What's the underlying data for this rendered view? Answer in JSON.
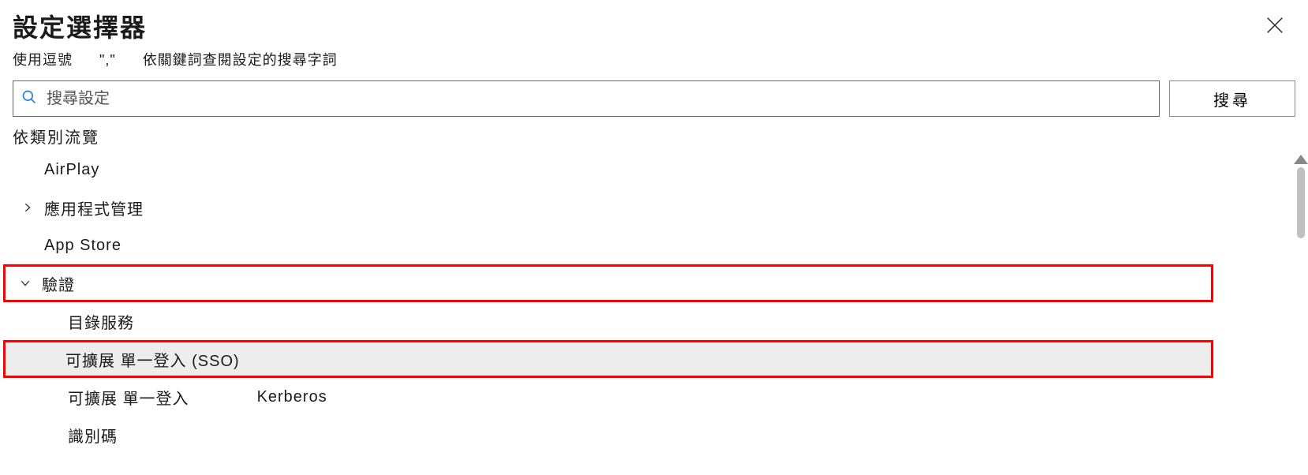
{
  "header": {
    "title": "設定選擇器",
    "subtitle_prefix": "使用逗號",
    "subtitle_comma": "\",\"",
    "subtitle_suffix": "依關鍵詞查閱設定的搜尋字詞"
  },
  "search": {
    "placeholder": "搜尋設定",
    "button_label": "搜尋"
  },
  "browse": {
    "label": "依類別流覽"
  },
  "tree": {
    "airplay": "AirPlay",
    "app_management": "應用程式管理",
    "app_store": "App Store",
    "authentication": "驗證",
    "directory_service": "目錄服務",
    "extensible_sso": "可擴展 單一登入 (SSO)",
    "extensible_sso_kerberos_p1": "可擴展 單一登入",
    "extensible_sso_kerberos_p2": "Kerberos",
    "identifier": "識別碼"
  }
}
